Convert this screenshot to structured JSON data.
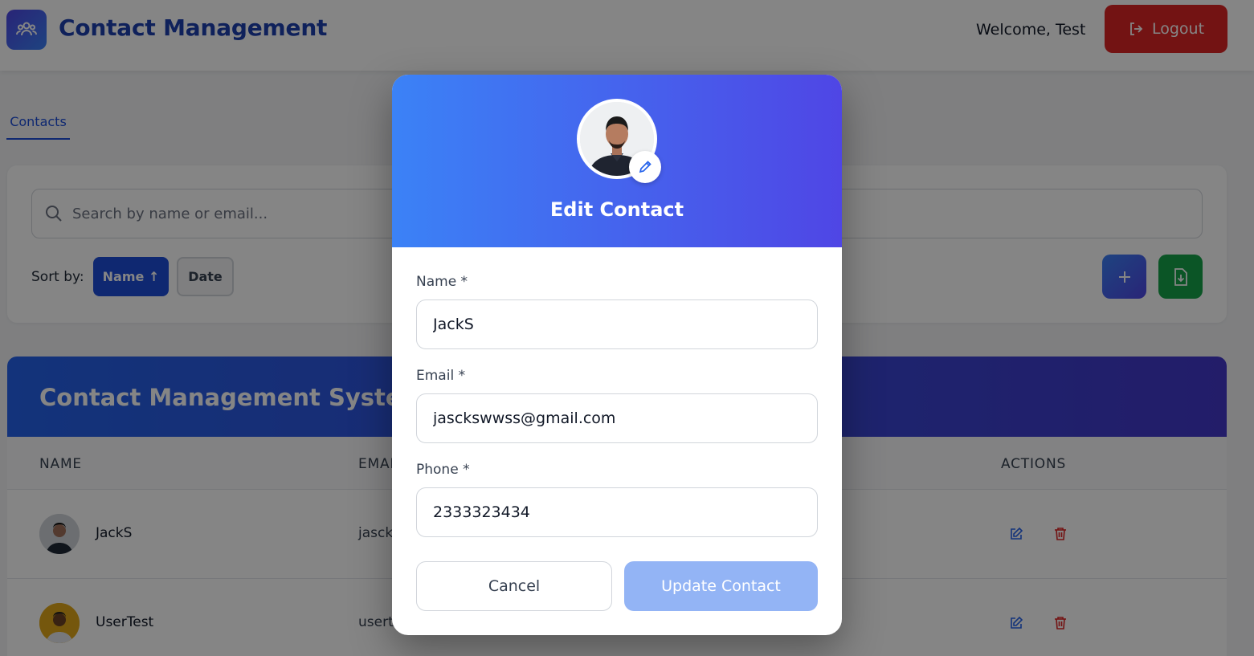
{
  "header": {
    "app_title": "Contact Management",
    "welcome_text": "Welcome, Test",
    "logout_label": "Logout"
  },
  "tabs": [
    {
      "label": "Contacts",
      "active": true
    }
  ],
  "filters": {
    "search_placeholder": "Search by name or email...",
    "sort_label": "Sort by:",
    "sort_options": [
      {
        "label": "Name ↑",
        "active": true
      },
      {
        "label": "Date",
        "active": false
      }
    ]
  },
  "table": {
    "title": "Contact Management System",
    "columns": [
      "NAME",
      "EMAIL",
      "ACTIONS"
    ],
    "rows": [
      {
        "name": "JackS",
        "email": "jascks"
      },
      {
        "name": "UserTest",
        "email": "userte"
      }
    ]
  },
  "modal": {
    "title": "Edit Contact",
    "fields": [
      {
        "label": "Name *",
        "value": "JackS"
      },
      {
        "label": "Email *",
        "value": "jasckswwss@gmail.com"
      },
      {
        "label": "Phone *",
        "value": "2333323434"
      }
    ],
    "cancel_label": "Cancel",
    "submit_label": "Update Contact"
  },
  "colors": {
    "primary": "#1d4ed8",
    "danger": "#dc2626",
    "success": "#16a34a",
    "gradient_start": "#3b82f6",
    "gradient_end": "#4f46e5",
    "disabled_submit": "#93b4f5"
  },
  "icons": {
    "logo": "users-icon",
    "logout": "logout-icon",
    "search": "search-icon",
    "add": "plus-icon",
    "export": "file-download-icon",
    "avatar_edit": "pencil-icon",
    "row_edit": "edit-icon",
    "row_delete": "trash-icon"
  }
}
